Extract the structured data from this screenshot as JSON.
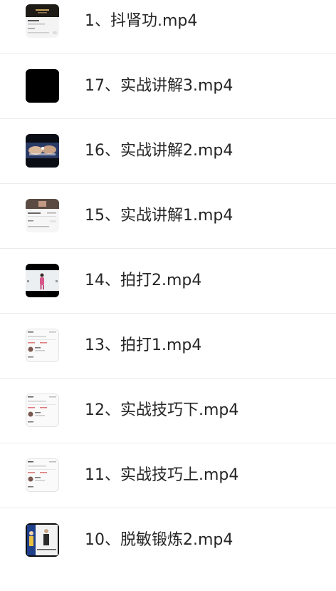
{
  "file_list": {
    "items": [
      {
        "name": "1、抖肾功.mp4",
        "thumbnail": "dark-title-app-screenshot"
      },
      {
        "name": "17、实战讲解3.mp4",
        "thumbnail": "black-frame"
      },
      {
        "name": "16、实战讲解2.mp4",
        "thumbnail": "hands-closeup"
      },
      {
        "name": "15、实战讲解1.mp4",
        "thumbnail": "app-screenshot-with-photo"
      },
      {
        "name": "14、拍打2.mp4",
        "thumbnail": "person-standing-video"
      },
      {
        "name": "13、拍打1.mp4",
        "thumbnail": "chat-screenshot"
      },
      {
        "name": "12、实战技巧下.mp4",
        "thumbnail": "chat-screenshot"
      },
      {
        "name": "11、实战技巧上.mp4",
        "thumbnail": "chat-screenshot"
      },
      {
        "name": "10、脱敏锻炼2.mp4",
        "thumbnail": "person-blue-video"
      }
    ]
  }
}
